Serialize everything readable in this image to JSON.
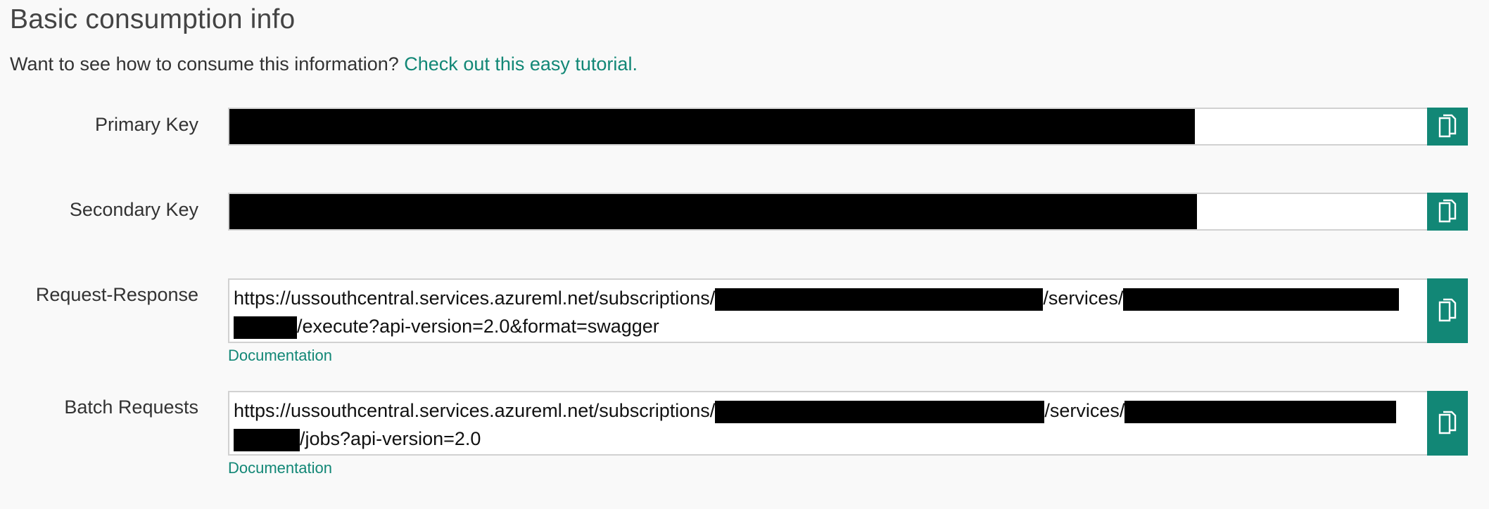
{
  "header": {
    "title": "Basic consumption info",
    "intro_text": "Want to see how to consume this information? ",
    "tutorial_link": "Check out this easy tutorial."
  },
  "fields": {
    "primary_key": {
      "label": "Primary Key"
    },
    "secondary_key": {
      "label": "Secondary Key"
    },
    "request_response": {
      "label": "Request-Response",
      "url_prefix": "https://ussouthcentral.services.azureml.net/subscriptions/",
      "url_mid": "/services/",
      "url_suffix": "/execute?api-version=2.0&format=swagger",
      "doc_link": "Documentation"
    },
    "batch_requests": {
      "label": "Batch Requests",
      "url_prefix": "https://ussouthcentral.services.azureml.net/subscriptions/",
      "url_mid": "/services/",
      "url_suffix": "/jobs?api-version=2.0",
      "doc_link": "Documentation"
    }
  },
  "icons": {
    "copy": "copy-icon"
  },
  "colors": {
    "accent": "#128776",
    "redaction": "#000000"
  }
}
